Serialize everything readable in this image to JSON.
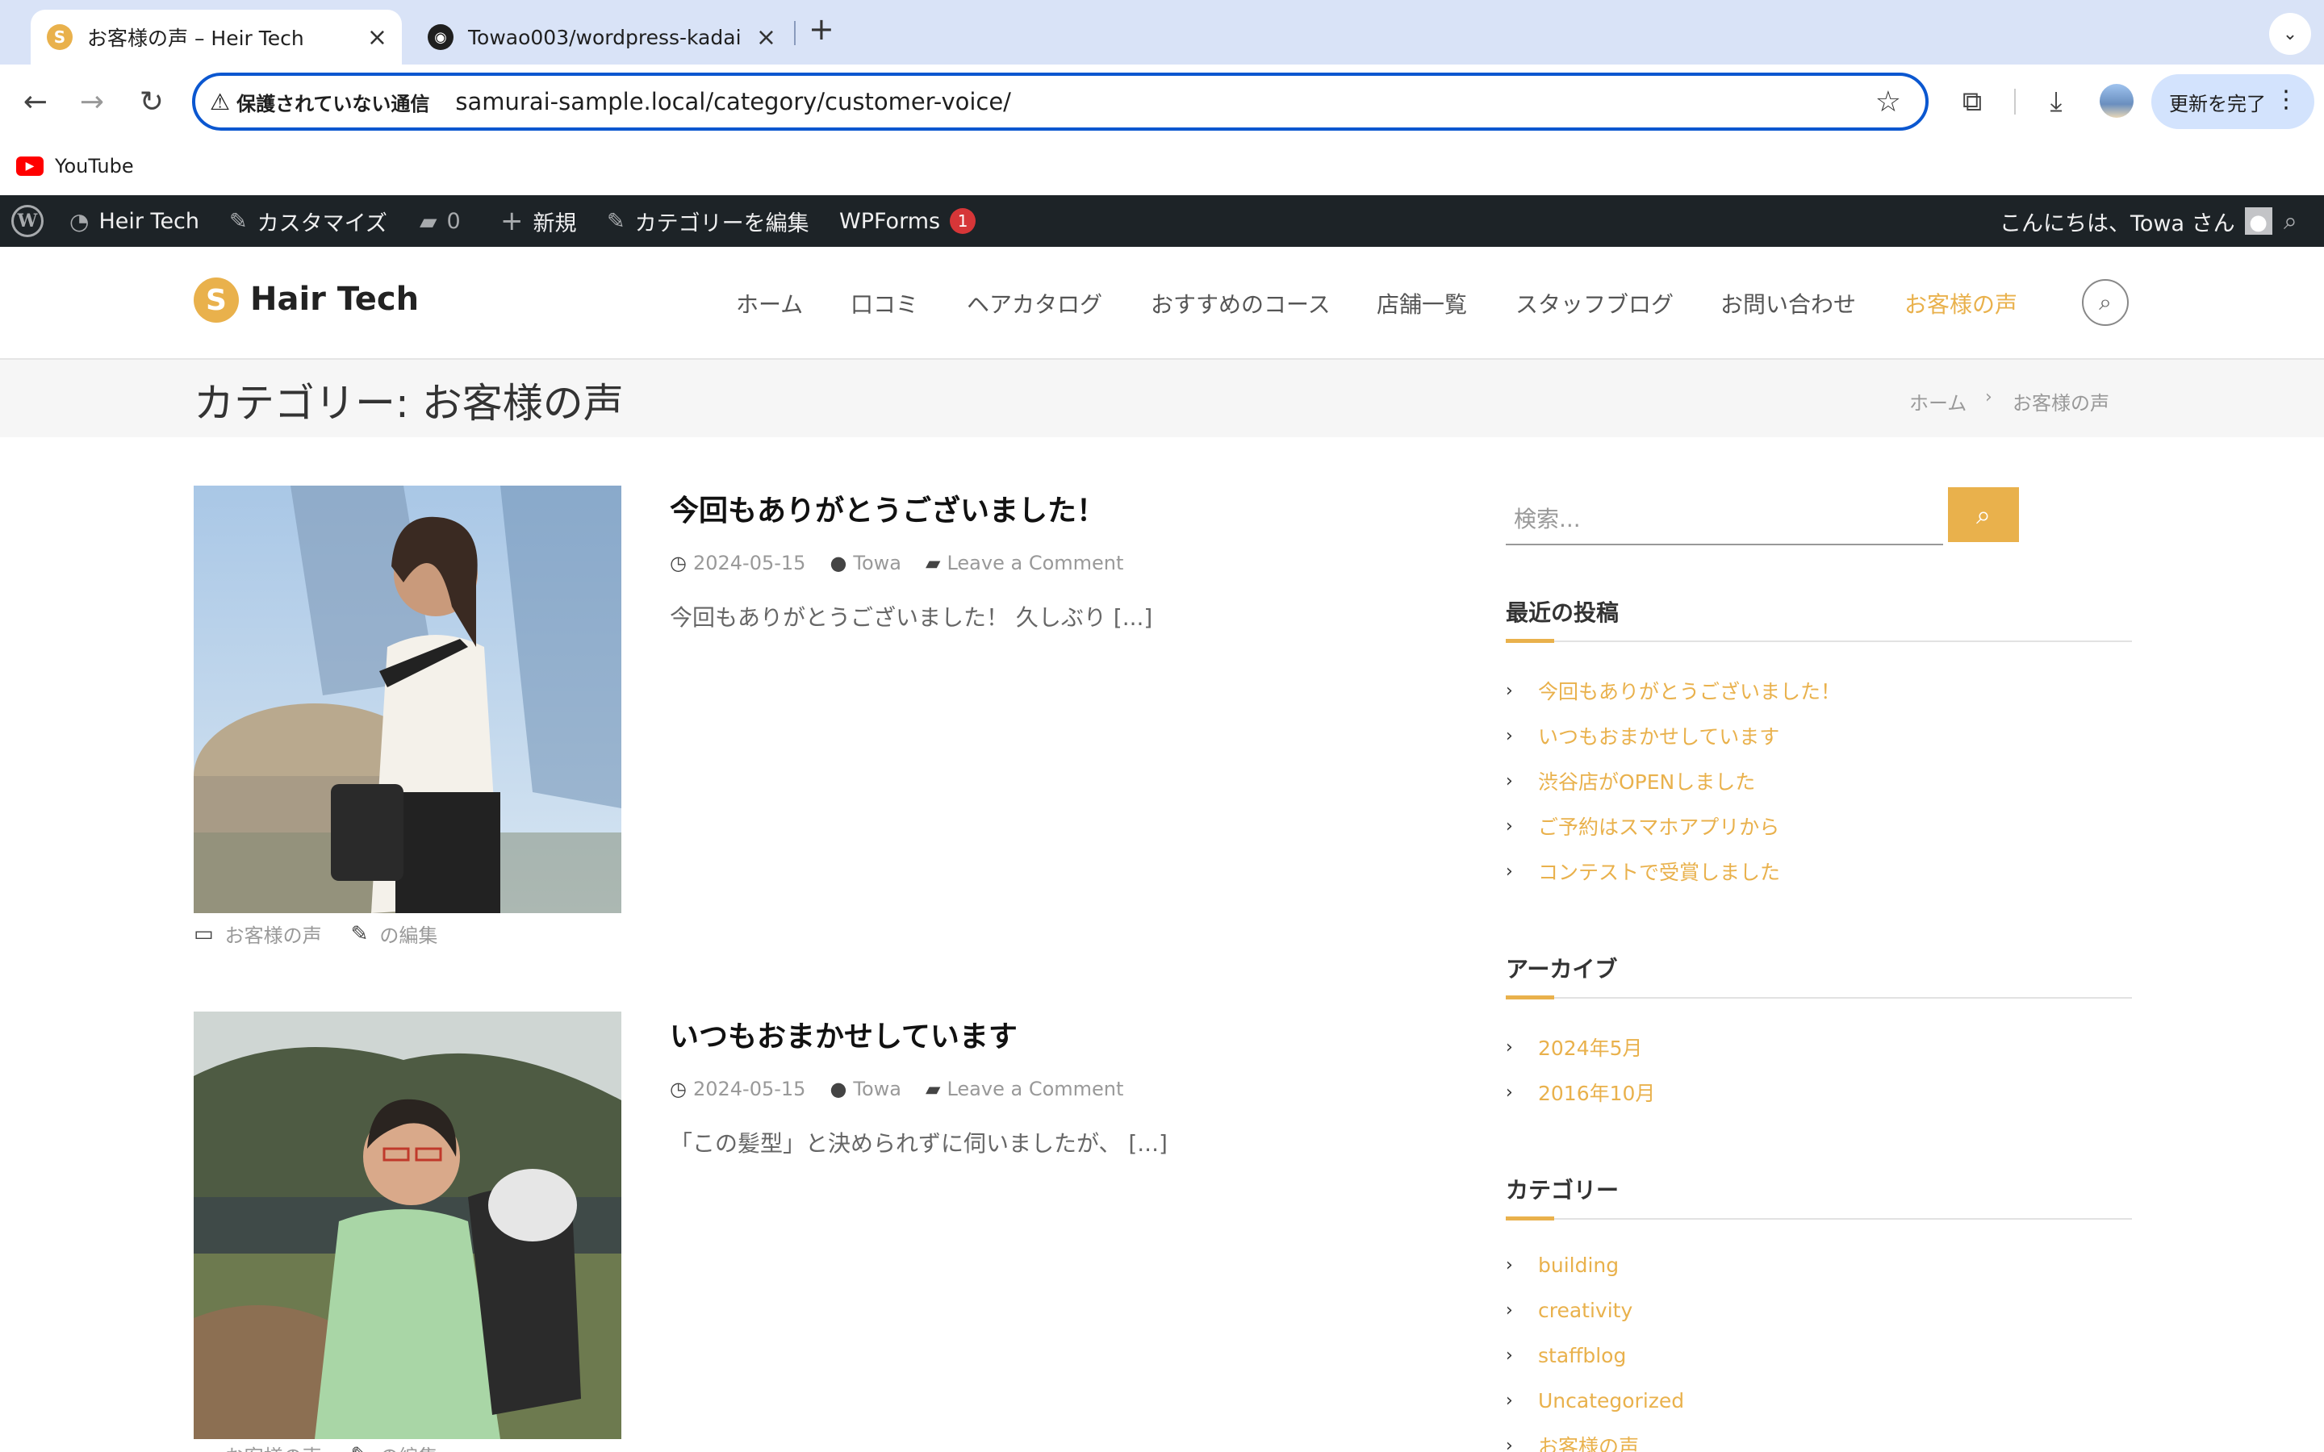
{
  "browser": {
    "tabs": [
      {
        "title": "お客様の声 – Heir Tech",
        "active": true
      },
      {
        "title": "Towao003/wordpress-kadai",
        "active": false
      }
    ],
    "new_tab": "+",
    "address": {
      "security_label": "保護されていない通信",
      "url": "samurai-sample.local/category/customer-voice/"
    },
    "update_button": "更新を完了",
    "bookmarks": [
      {
        "label": "YouTube"
      }
    ]
  },
  "adminbar": {
    "site_name": "Heir Tech",
    "customize": "カスタマイズ",
    "comments_count": "0",
    "new": "新規",
    "edit_category": "カテゴリーを編集",
    "wpforms": "WPForms",
    "wpforms_badge": "1",
    "greeting": "こんにちは、Towa さん"
  },
  "site": {
    "title": "Hair Tech",
    "accent_color": "#e9b14c",
    "menu": [
      {
        "label": "ホーム"
      },
      {
        "label": "口コミ"
      },
      {
        "label": "ヘアカタログ"
      },
      {
        "label": "おすすめのコース"
      },
      {
        "label": "店舗一覧"
      },
      {
        "label": "スタッフブログ"
      },
      {
        "label": "お問い合わせ"
      },
      {
        "label": "お客様の声",
        "current": true
      }
    ]
  },
  "page": {
    "title": "カテゴリー: お客様の声",
    "breadcrumb": [
      "ホーム",
      "お客様の声"
    ]
  },
  "posts": [
    {
      "title": "今回もありがとうございました！",
      "date": "2024-05-15",
      "author": "Towa",
      "comments": "Leave a Comment",
      "excerpt": "今回もありがとうございました！ 久しぶり [...]",
      "category": "お客様の声",
      "edit": "の編集"
    },
    {
      "title": "いつもおまかせしています",
      "date": "2024-05-15",
      "author": "Towa",
      "comments": "Leave a Comment",
      "excerpt": "「この髪型」と決められずに伺いましたが、 [...]",
      "category": "お客様の声",
      "edit": "の編集"
    }
  ],
  "sidebar": {
    "search_placeholder": "検索...",
    "recent_title": "最近の投稿",
    "recent": [
      {
        "label": "今回もありがとうございました！"
      },
      {
        "label": "いつもおまかせしています"
      },
      {
        "label": "渋谷店がOPENしました"
      },
      {
        "label": "ご予約はスマホアプリから"
      },
      {
        "label": "コンテストで受賞しました"
      }
    ],
    "archive_title": "アーカイブ",
    "archives": [
      {
        "label": "2024年5月"
      },
      {
        "label": "2016年10月"
      }
    ],
    "category_title": "カテゴリー",
    "categories": [
      {
        "label": "building"
      },
      {
        "label": "creativity"
      },
      {
        "label": "staffblog"
      },
      {
        "label": "Uncategorized"
      },
      {
        "label": "お客様の声"
      }
    ]
  }
}
